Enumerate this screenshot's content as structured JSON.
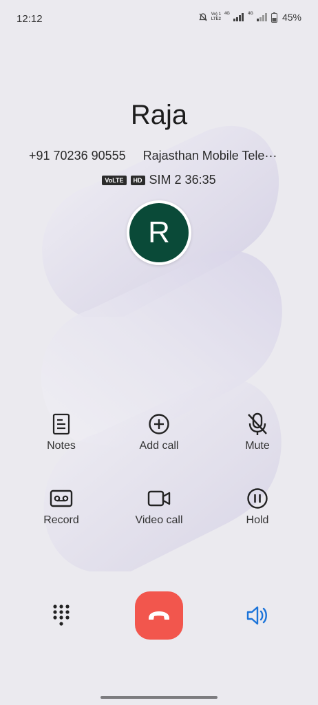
{
  "status_bar": {
    "time": "12:12",
    "sim1_label_top": "Vo) 1",
    "sim1_label_bottom": "LTE2",
    "net1": "4G",
    "net2": "4G",
    "battery": "45%"
  },
  "caller": {
    "name": "Raja",
    "number": "+91 70236 90555",
    "carrier": "Rajasthan Mobile Tele···",
    "volte_tag": "VoLTE",
    "hd_tag": "HD",
    "sim_and_duration": "SIM 2 36:35",
    "avatar_initial": "R",
    "avatar_color": "#0a4a38"
  },
  "actions": [
    {
      "label": "Notes",
      "icon": "notes-icon"
    },
    {
      "label": "Add call",
      "icon": "add-call-icon"
    },
    {
      "label": "Mute",
      "icon": "mute-icon"
    },
    {
      "label": "Record",
      "icon": "record-icon"
    },
    {
      "label": "Video call",
      "icon": "video-call-icon"
    },
    {
      "label": "Hold",
      "icon": "hold-icon"
    }
  ],
  "bottom": {
    "dialpad_icon": "dialpad-icon",
    "end_call_icon": "end-call-icon",
    "end_call_color": "#f2564d",
    "speaker_icon": "speaker-icon",
    "speaker_color": "#1a73d9"
  }
}
